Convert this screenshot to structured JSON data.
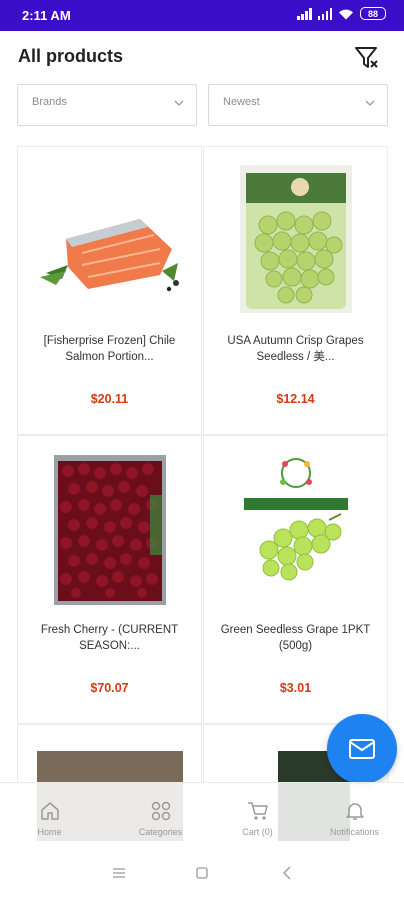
{
  "status_bar": {
    "time": "2:11 AM",
    "battery": "88"
  },
  "header": {
    "title": "All products"
  },
  "filters": {
    "brand_placeholder": "Brands",
    "sort_value": "Newest"
  },
  "products": [
    {
      "name": "[Fisherprise Frozen] Chile Salmon Portion...",
      "price": "$20.11",
      "image": "salmon-fillet"
    },
    {
      "name": "USA Autumn Crisp Grapes Seedless / 美...",
      "price": "$12.14",
      "image": "green-grapes-bag"
    },
    {
      "name": "Fresh Cherry - (CURRENT SEASON:...",
      "price": "$70.07",
      "image": "cherries-box"
    },
    {
      "name": "Green Seedless Grape 1PKT (500g)",
      "price": "$3.01",
      "image": "green-grapes-bunch"
    }
  ],
  "nav": {
    "home": "Home",
    "categories": "Categories",
    "cart": "Cart (0)",
    "notifications": "Notifications"
  },
  "colors": {
    "status_bar": "#3b0fc9",
    "price": "#d43b14",
    "fab": "#1e82f0"
  },
  "icons": {
    "filter": "filter-icon",
    "fab": "mail-icon"
  }
}
